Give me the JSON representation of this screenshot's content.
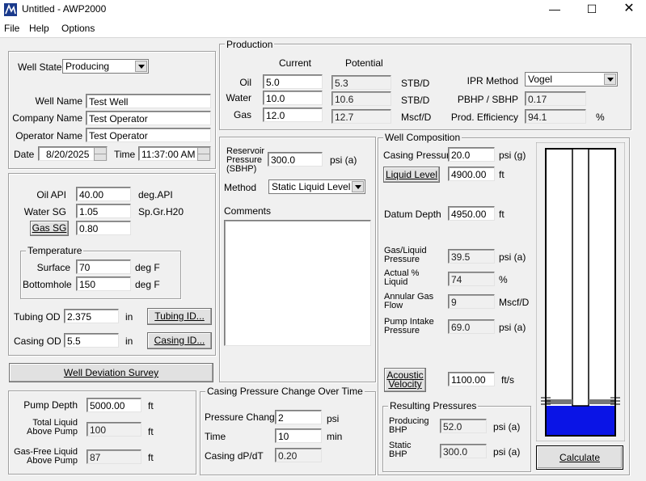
{
  "window": {
    "title": "Untitled - AWP2000"
  },
  "menu": [
    "File",
    "Help",
    "Options"
  ],
  "well": {
    "state_label": "Well State",
    "state": "Producing",
    "name_label": "Well Name",
    "name": "Test Well",
    "company_label": "Company Name",
    "company": "Test Operator",
    "operator_label": "Operator Name",
    "operator": "Test Operator",
    "date_label": "Date",
    "date": "8/20/2025",
    "time_label": "Time",
    "time": "11:37:00 AM"
  },
  "fluid": {
    "oil_api_label": "Oil API",
    "oil_api": "40.00",
    "oil_api_unit": "deg.API",
    "water_sg_label": "Water SG",
    "water_sg": "1.05",
    "water_sg_unit": "Sp.Gr.H20",
    "gas_sg_button": "Gas SG",
    "gas_sg": "0.80",
    "temperature_title": "Temperature",
    "surface_label": "Surface",
    "surface": "70",
    "surface_unit": "deg F",
    "bottomhole_label": "Bottomhole",
    "bottomhole": "150",
    "bottomhole_unit": "deg F",
    "tubing_od_label": "Tubing OD",
    "tubing_od": "2.375",
    "tubing_od_unit": "in",
    "tubing_id_button": "Tubing ID...",
    "casing_od_label": "Casing OD",
    "casing_od": "5.5",
    "casing_od_unit": "in",
    "casing_id_button": "Casing ID..."
  },
  "deviation_button": "Well Deviation Survey",
  "pump": {
    "depth_label": "Pump Depth",
    "depth": "5000.00",
    "depth_unit": "ft",
    "total_liquid_label_1": "Total Liquid",
    "total_liquid_label_2": "Above Pump",
    "total_liquid": "100",
    "total_liquid_unit": "ft",
    "gas_free_label_1": "Gas-Free Liquid",
    "gas_free_label_2": "Above Pump",
    "gas_free": "87",
    "gas_free_unit": "ft"
  },
  "production": {
    "title": "Production",
    "current_header": "Current",
    "potential_header": "Potential",
    "rows": [
      {
        "label": "Oil",
        "current": "5.0",
        "potential": "5.3",
        "unit": "STB/D"
      },
      {
        "label": "Water",
        "current": "10.0",
        "potential": "10.6",
        "unit": "STB/D"
      },
      {
        "label": "Gas",
        "current": "12.0",
        "potential": "12.7",
        "unit": "Mscf/D"
      }
    ],
    "ipr_label": "IPR Method",
    "ipr": "Vogel",
    "pbhp_label": "PBHP / SBHP",
    "pbhp": "0.17",
    "eff_label": "Prod. Efficiency",
    "eff": "94.1",
    "eff_unit": "%"
  },
  "reservoir": {
    "label_1": "Reservoir",
    "label_2": "Pressure",
    "label_3": "(SBHP)",
    "value": "300.0",
    "unit": "psi (a)",
    "method_label": "Method",
    "method": "Static Liquid Level",
    "comments_label": "Comments",
    "comments": ""
  },
  "casing_change": {
    "title": "Casing Pressure Change Over Time",
    "pressure_change_label": "Pressure Change",
    "pressure_change": "2",
    "pressure_change_unit": "psi",
    "time_label": "Time",
    "time": "10",
    "time_unit": "min",
    "dpdt_label": "Casing dP/dT",
    "dpdt": "0.20"
  },
  "composition": {
    "title": "Well Composition",
    "casing_pressure_label": "Casing Pressure",
    "casing_pressure": "20.0",
    "casing_pressure_unit": "psi (g)",
    "liquid_level_button": "Liquid Level",
    "liquid_level": "4900.00",
    "liquid_level_unit": "ft",
    "datum_label": "Datum Depth",
    "datum": "4950.00",
    "datum_unit": "ft",
    "gl_label_1": "Gas/Liquid",
    "gl_label_2": "Pressure",
    "gl": "39.5",
    "gl_unit": "psi (a)",
    "pct_label_1": "Actual %",
    "pct_label_2": "Liquid",
    "pct": "74",
    "pct_unit": "%",
    "agf_label_1": "Annular Gas",
    "agf_label_2": "Flow",
    "agf": "9",
    "agf_unit": "Mscf/D",
    "pip_label_1": "Pump Intake",
    "pip_label_2": "Pressure",
    "pip": "69.0",
    "pip_unit": "psi (a)",
    "acoustic_label_1": "Acoustic",
    "acoustic_label_2": "Velocity",
    "acoustic": "1100.00",
    "acoustic_unit": "ft/s"
  },
  "results": {
    "title": "Resulting Pressures",
    "producing_label_1": "Producing",
    "producing_label_2": "BHP",
    "producing": "52.0",
    "producing_unit": "psi (a)",
    "static_label_1": "Static",
    "static_label_2": "BHP",
    "static": "300.0",
    "static_unit": "psi (a)"
  },
  "calculate_button": "Calculate",
  "wellbore": {
    "liquid_color": "#0a14e6",
    "liquid_fraction": 0.24
  }
}
